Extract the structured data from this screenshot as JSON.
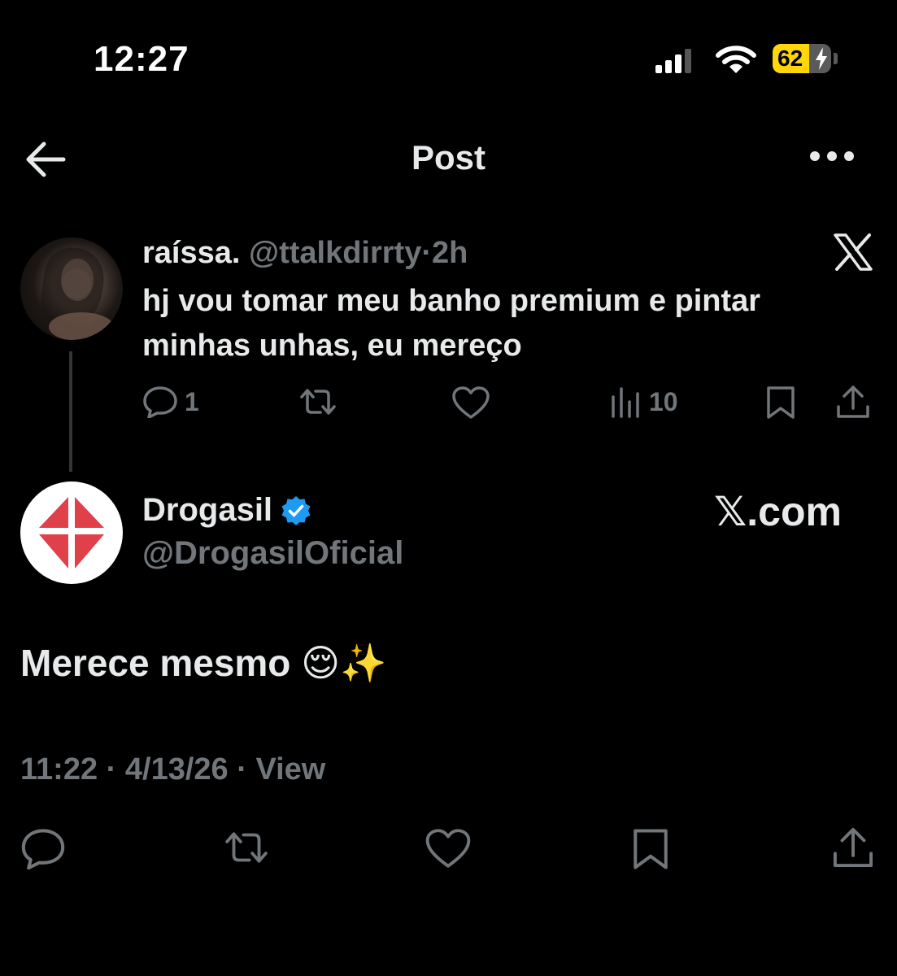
{
  "status_bar": {
    "time": "12:27",
    "battery_level": "62",
    "battery_fraction": 0.62,
    "battery_color": "#ffd60a",
    "icons": [
      "signal-icon",
      "wifi-icon",
      "battery-icon",
      "charging-bolt-icon"
    ]
  },
  "header": {
    "title": "Post",
    "back_icon": "arrow-left-icon",
    "more_icon": "ellipsis-icon"
  },
  "parent_post": {
    "display_name": "raíssa.",
    "handle": "@ttalkdirrty",
    "separator": "·",
    "time_ago": "2h",
    "text": "hj vou tomar meu banho premium e pintar minhas unhas, eu mereço",
    "replies": "1",
    "views": "10",
    "platform_icon": "x-logo-icon"
  },
  "main_post": {
    "display_name": "Drogasil",
    "handle": "@DrogasilOficial",
    "verified": true,
    "verified_color": "#1d9bf0",
    "brand_color": "#e0404a",
    "watermark": "𝕏.com",
    "text": "Merece mesmo 😌✨",
    "time": "11:22",
    "date": "4/13/26",
    "view_label": "View",
    "separator": "·"
  },
  "colors": {
    "background": "#000000",
    "text_primary": "#e7e9ea",
    "text_secondary": "#71767b"
  }
}
